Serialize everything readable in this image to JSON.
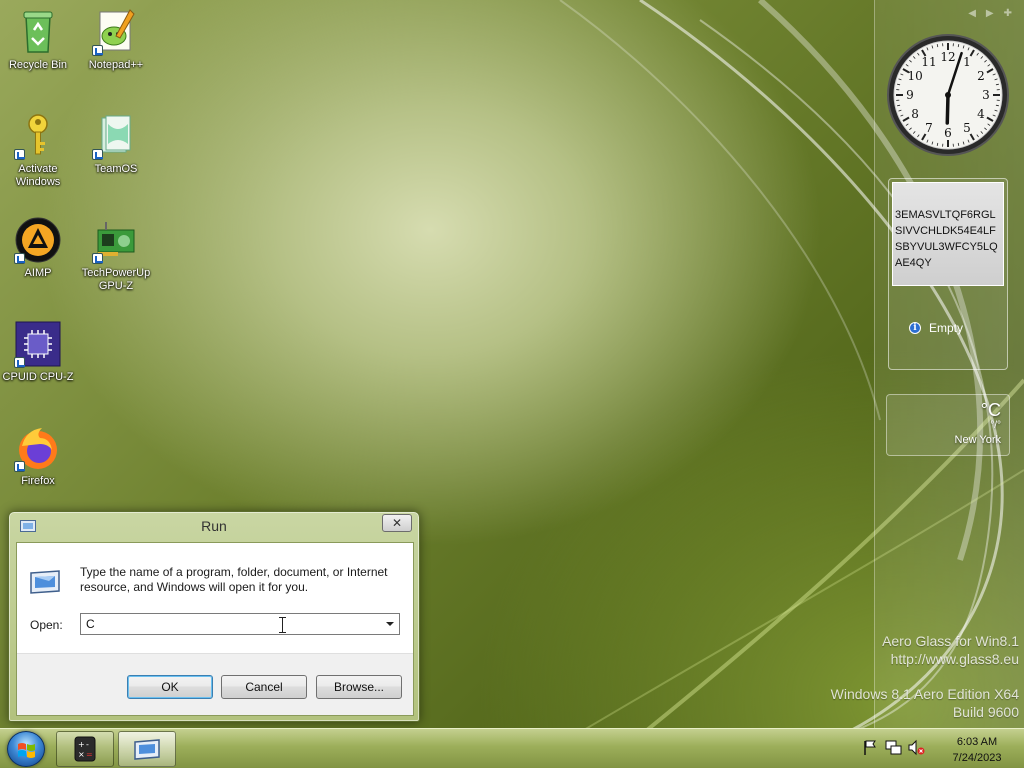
{
  "desktop_icons": [
    {
      "label": "Recycle Bin",
      "icon": "recycle-bin-icon"
    },
    {
      "label": "Notepad++",
      "icon": "notepad-plus-plus-icon"
    },
    {
      "label": "Activate Windows",
      "icon": "key-icon"
    },
    {
      "label": "TeamOS",
      "icon": "teamos-icon"
    },
    {
      "label": "AIMP",
      "icon": "aimp-icon"
    },
    {
      "label": "TechPowerUp GPU-Z",
      "icon": "gpu-z-icon"
    },
    {
      "label": "CPUID CPU-Z",
      "icon": "cpu-z-icon"
    },
    {
      "label": "Firefox",
      "icon": "firefox-icon"
    }
  ],
  "sidebar": {
    "clock": {
      "hour": 6,
      "minute": 3,
      "numerals": [
        "12",
        "1",
        "2",
        "3",
        "4",
        "5",
        "6",
        "7",
        "8",
        "9",
        "10",
        "11"
      ]
    },
    "notes": {
      "text": "3EMASVLTQF6RGLSIVVCHLDK54E4LFSBYVUL3WFCY5LQAE4QY",
      "status": "Empty"
    },
    "weather": {
      "temp": "°C",
      "range": "°/°",
      "city": "New York"
    }
  },
  "watermark": {
    "line1": "Aero Glass for Win8.1",
    "line2": "http://www.glass8.eu",
    "line3": "Windows 8.1 Aero Edition X64",
    "line4": "Build 9600"
  },
  "run_dialog": {
    "title": "Run",
    "close_label": "✕",
    "description": "Type the name of a program, folder, document, or Internet resource, and Windows will open it for you.",
    "open_label": "Open:",
    "open_value": "C",
    "ok_label": "OK",
    "cancel_label": "Cancel",
    "browse_label": "Browse..."
  },
  "taskbar": {
    "time": "6:03 AM",
    "date": "7/24/2023",
    "items": [
      "calculator-icon",
      "run-icon"
    ]
  }
}
